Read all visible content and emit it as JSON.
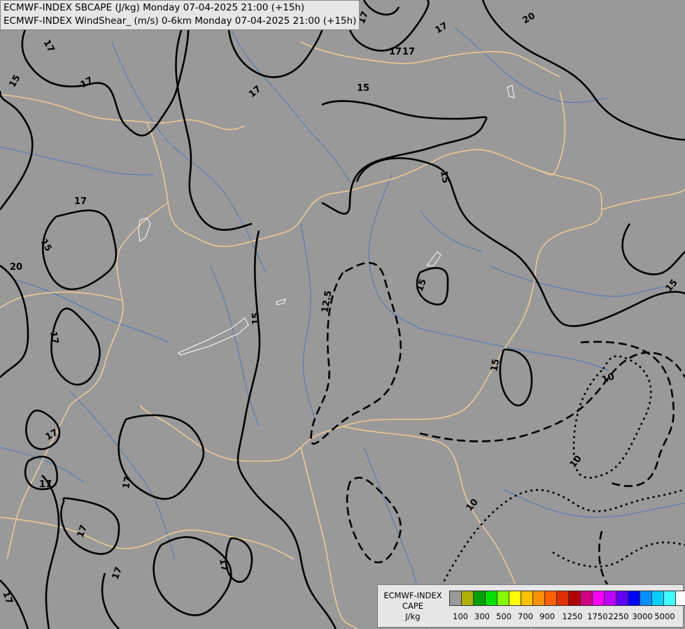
{
  "title_lines": [
    "ECMWF-INDEX SBCAPE (J/kg) Monday 07-04-2025 21:00 (+15h)",
    "ECMWF-INDEX WindShear_ (m/s) 0-6km Monday 07-04-2025 21:00 (+15h)"
  ],
  "colors": {
    "background": "#999999",
    "borders": "#f0c890",
    "rivers": "#3a70c8",
    "contours": "#000000",
    "lakes": "#ffffff"
  },
  "contour_labels": [
    {
      "text": "17"
    },
    {
      "text": "17"
    },
    {
      "text": "20"
    },
    {
      "text": "17"
    },
    {
      "text": "17"
    },
    {
      "text": "17"
    },
    {
      "text": "15"
    },
    {
      "text": "15"
    },
    {
      "text": "17"
    },
    {
      "text": "17"
    },
    {
      "text": "15"
    },
    {
      "text": "15"
    },
    {
      "text": "20"
    },
    {
      "text": "17"
    },
    {
      "text": "12.5"
    },
    {
      "text": "15"
    },
    {
      "text": "15"
    },
    {
      "text": "15"
    },
    {
      "text": "15"
    },
    {
      "text": "10"
    },
    {
      "text": "10"
    },
    {
      "text": "10"
    },
    {
      "text": "17"
    },
    {
      "text": "17"
    },
    {
      "text": "17"
    },
    {
      "text": "17"
    },
    {
      "text": "17"
    },
    {
      "text": "17"
    },
    {
      "text": "17"
    },
    {
      "text": "17"
    }
  ],
  "legend": {
    "title_lines": [
      "ECMWF-INDEX",
      "CAPE",
      "J/kg"
    ],
    "swatch_colors": [
      "#999999",
      "#b0b000",
      "#00a000",
      "#00e000",
      "#80ff00",
      "#ffff00",
      "#ffc000",
      "#ff9000",
      "#ff6000",
      "#e03000",
      "#b00000",
      "#d00080",
      "#ff00ff",
      "#c000ff",
      "#6000ff",
      "#0000ff",
      "#0090ff",
      "#00d0ff",
      "#40ffff",
      "#ffffff"
    ],
    "tick_labels": [
      "100",
      "300",
      "500",
      "700",
      "900",
      "1250",
      "1750",
      "2250",
      "3000",
      "5000"
    ]
  }
}
